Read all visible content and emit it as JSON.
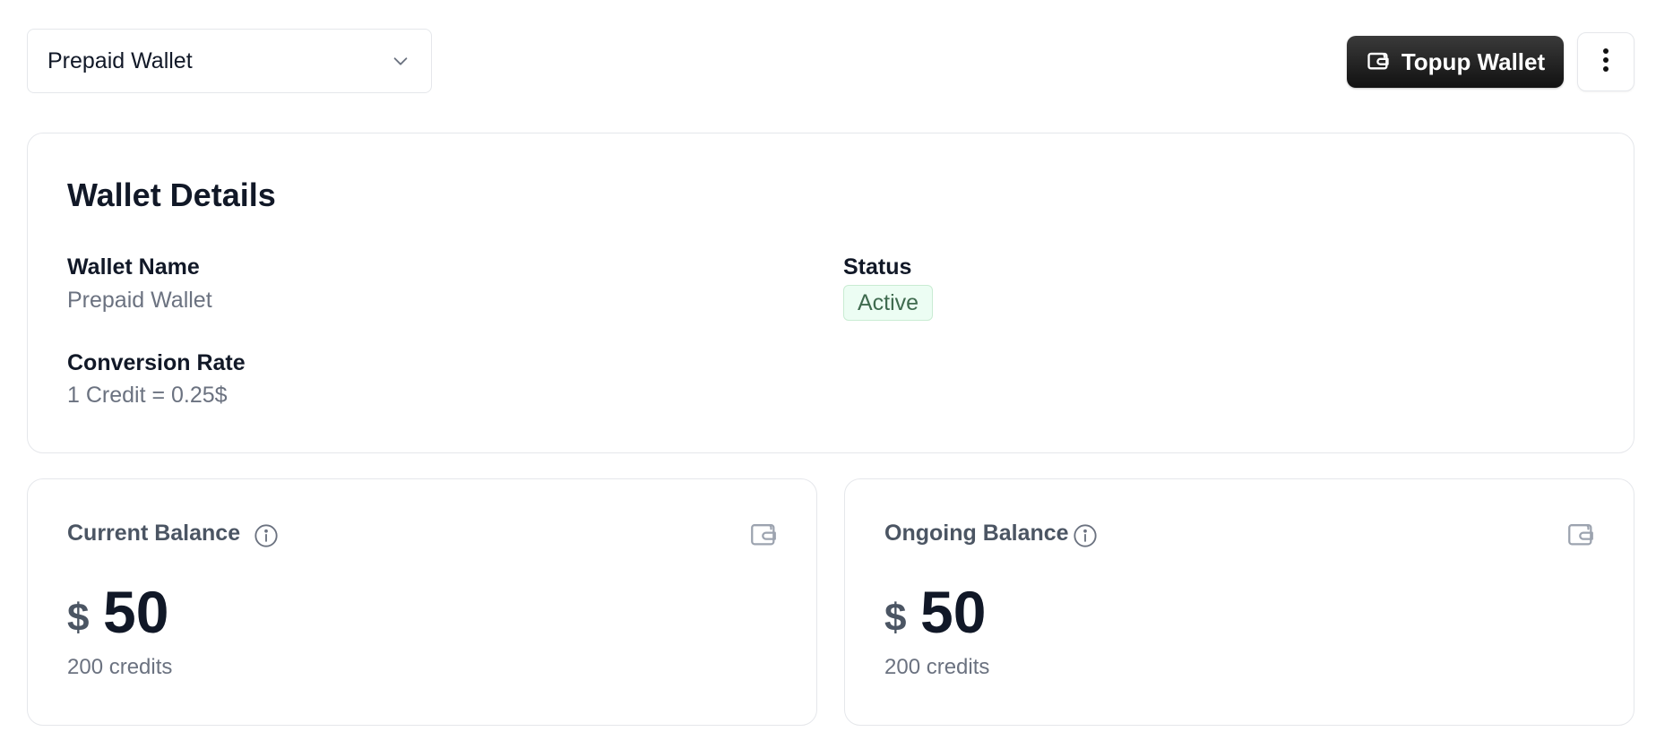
{
  "wallet_selector": {
    "selected": "Prepaid Wallet",
    "icon": "chevron-down-icon"
  },
  "actions": {
    "topup_label": "Topup Wallet",
    "topup_icon": "wallet-icon",
    "more_icon": "more-vertical-icon"
  },
  "details": {
    "title": "Wallet Details",
    "wallet_name_label": "Wallet Name",
    "wallet_name_value": "Prepaid Wallet",
    "status_label": "Status",
    "status_value": "Active",
    "conversion_label": "Conversion Rate",
    "conversion_value": "1 Credit = 0.25$"
  },
  "balances": {
    "current": {
      "title": "Current Balance",
      "currency": "$",
      "amount": "50",
      "credits": "200 credits"
    },
    "ongoing": {
      "title": "Ongoing Balance",
      "currency": "$",
      "amount": "50",
      "credits": "200 credits"
    }
  },
  "colors": {
    "accent_dark": "#111111",
    "status_bg": "#ecfdf3",
    "status_text": "#3f6b4f",
    "muted_text": "#6b7280"
  }
}
